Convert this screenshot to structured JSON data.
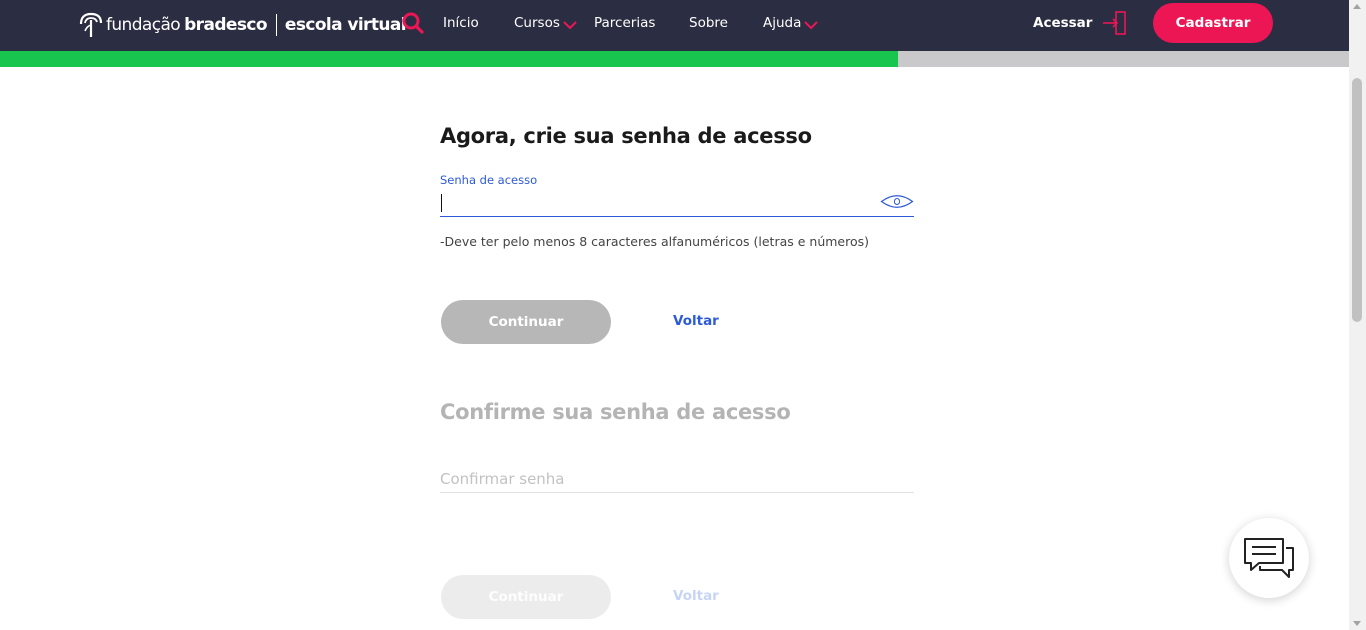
{
  "header": {
    "brand_primary": "fundação",
    "brand_secondary": "bradesco",
    "brand_product": "escola virtual",
    "nav": [
      {
        "label": "Início",
        "has_dropdown": false
      },
      {
        "label": "Cursos",
        "has_dropdown": true
      },
      {
        "label": "Parcerias",
        "has_dropdown": false
      },
      {
        "label": "Sobre",
        "has_dropdown": false
      },
      {
        "label": "Ajuda",
        "has_dropdown": true
      }
    ],
    "login_label": "Acessar",
    "signup_label": "Cadastrar"
  },
  "progress": {
    "fraction": 0.666
  },
  "step_password": {
    "title": "Agora, crie sua senha de acesso",
    "field_label": "Senha de acesso",
    "field_value": "",
    "hint": "-Deve ter pelo menos 8 caracteres alfanuméricos (letras e números)",
    "continue_label": "Continuar",
    "back_label": "Voltar"
  },
  "step_confirm": {
    "title": "Confirme sua senha de acesso",
    "placeholder": "Confirmar senha",
    "continue_label": "Continuar",
    "back_label": "Voltar"
  },
  "icons": {
    "logo": "bradesco-tree-logo",
    "search": "search-icon",
    "chevron": "chevron-down-icon",
    "login": "login-door-icon",
    "eye": "eye-icon",
    "chat": "chat-bubbles-icon"
  },
  "colors": {
    "nav_bg": "#2b2d42",
    "accent": "#ec1655",
    "progress_fill": "#18c64f",
    "progress_track": "#c9c9cb",
    "link": "#2d5ad8",
    "disabled_button": "#b7b7b7"
  }
}
